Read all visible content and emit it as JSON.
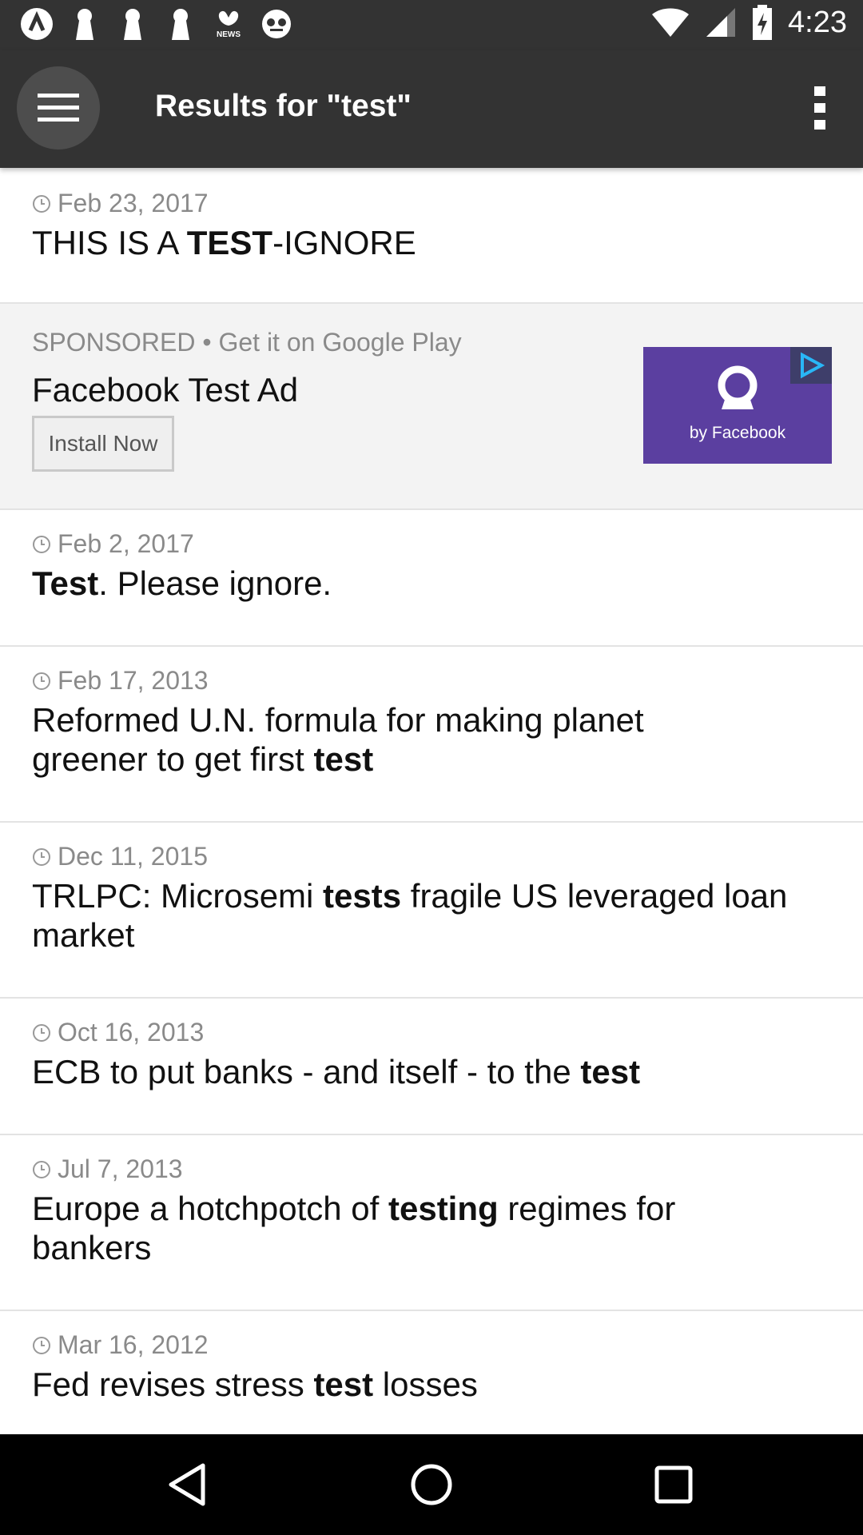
{
  "status_bar": {
    "time": "4:23",
    "left_icons": [
      "app-notification-icon",
      "keyhole-icon",
      "keyhole-icon",
      "keyhole-icon",
      "nbc-news-icon",
      "voicemail-icon"
    ],
    "right_icons": [
      "wifi-icon",
      "cellular-signal-icon",
      "battery-charging-icon"
    ]
  },
  "app_bar": {
    "title": "Results for \"test\"",
    "menu_icon": "hamburger-menu-icon",
    "overflow_icon": "overflow-menu-icon"
  },
  "results": [
    {
      "date": "Feb 23, 2017",
      "parts": [
        {
          "t": "THIS IS A ",
          "b": false
        },
        {
          "t": "TEST",
          "b": true
        },
        {
          "t": "-IGNORE",
          "b": false
        }
      ]
    },
    {
      "sponsored": true,
      "meta": "SPONSORED • Get it on Google Play",
      "title": "Facebook Test Ad",
      "button": "Install Now",
      "image_caption": "by Facebook"
    },
    {
      "date": "Feb 2, 2017",
      "parts": [
        {
          "t": "Test",
          "b": true
        },
        {
          "t": ". Please ignore.",
          "b": false
        }
      ]
    },
    {
      "date": "Feb 17, 2013",
      "parts": [
        {
          "t": "Reformed U.N. formula for making planet greener to get first ",
          "b": false
        },
        {
          "t": "test",
          "b": true
        }
      ]
    },
    {
      "date": "Dec 11, 2015",
      "parts": [
        {
          "t": "TRLPC: Microsemi ",
          "b": false
        },
        {
          "t": "tests",
          "b": true
        },
        {
          "t": " fragile US leveraged loan market",
          "b": false
        }
      ]
    },
    {
      "date": "Oct 16, 2013",
      "parts": [
        {
          "t": "ECB to put banks - and itself - to the ",
          "b": false
        },
        {
          "t": "test",
          "b": true
        }
      ]
    },
    {
      "date": "Jul 7, 2013",
      "parts": [
        {
          "t": "Europe a hotchpotch of ",
          "b": false
        },
        {
          "t": "testing",
          "b": true
        },
        {
          "t": " regimes for bankers",
          "b": false
        }
      ]
    },
    {
      "date": "Mar 16, 2012",
      "parts": [
        {
          "t": "Fed revises stress ",
          "b": false
        },
        {
          "t": "test",
          "b": true
        },
        {
          "t": " losses",
          "b": false
        }
      ]
    }
  ],
  "nav_bar": {
    "icons": [
      "back-icon",
      "home-icon",
      "recents-icon"
    ]
  }
}
